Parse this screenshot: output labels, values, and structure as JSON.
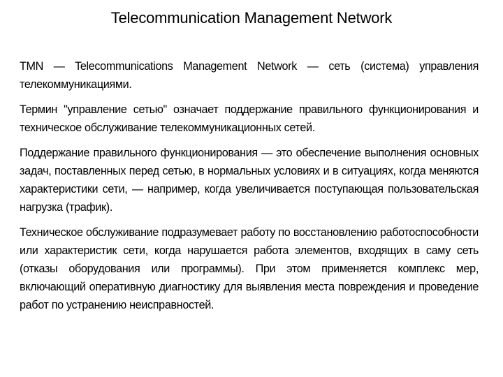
{
  "slide": {
    "title": "Telecommunication Management Network",
    "paragraphs": [
      "TMN — Telecommunications Management Network — сеть (система) управления телекоммуникациями.",
      "Термин \"управление сетью\" означает поддержание правильного функционирования и техническое обслуживание телекоммуникационных сетей.",
      "Поддержание правильного функционирования — это обеспечение выполнения основных задач, поставленных перед сетью, в нормальных условиях и в ситуациях, когда меняются характеристики сети, — например, когда увеличивается поступающая пользовательская нагрузка (трафик).",
      "Техническое обслуживание подразумевает работу по восстановлению работоспособности или характеристик сети, когда нарушается работа элементов, входящих в саму сеть (отказы оборудования или программы). При этом применяется комплекс мер, включающий оперативную диагностику для выявления места повреждения и проведение работ по устранению неисправностей."
    ]
  }
}
